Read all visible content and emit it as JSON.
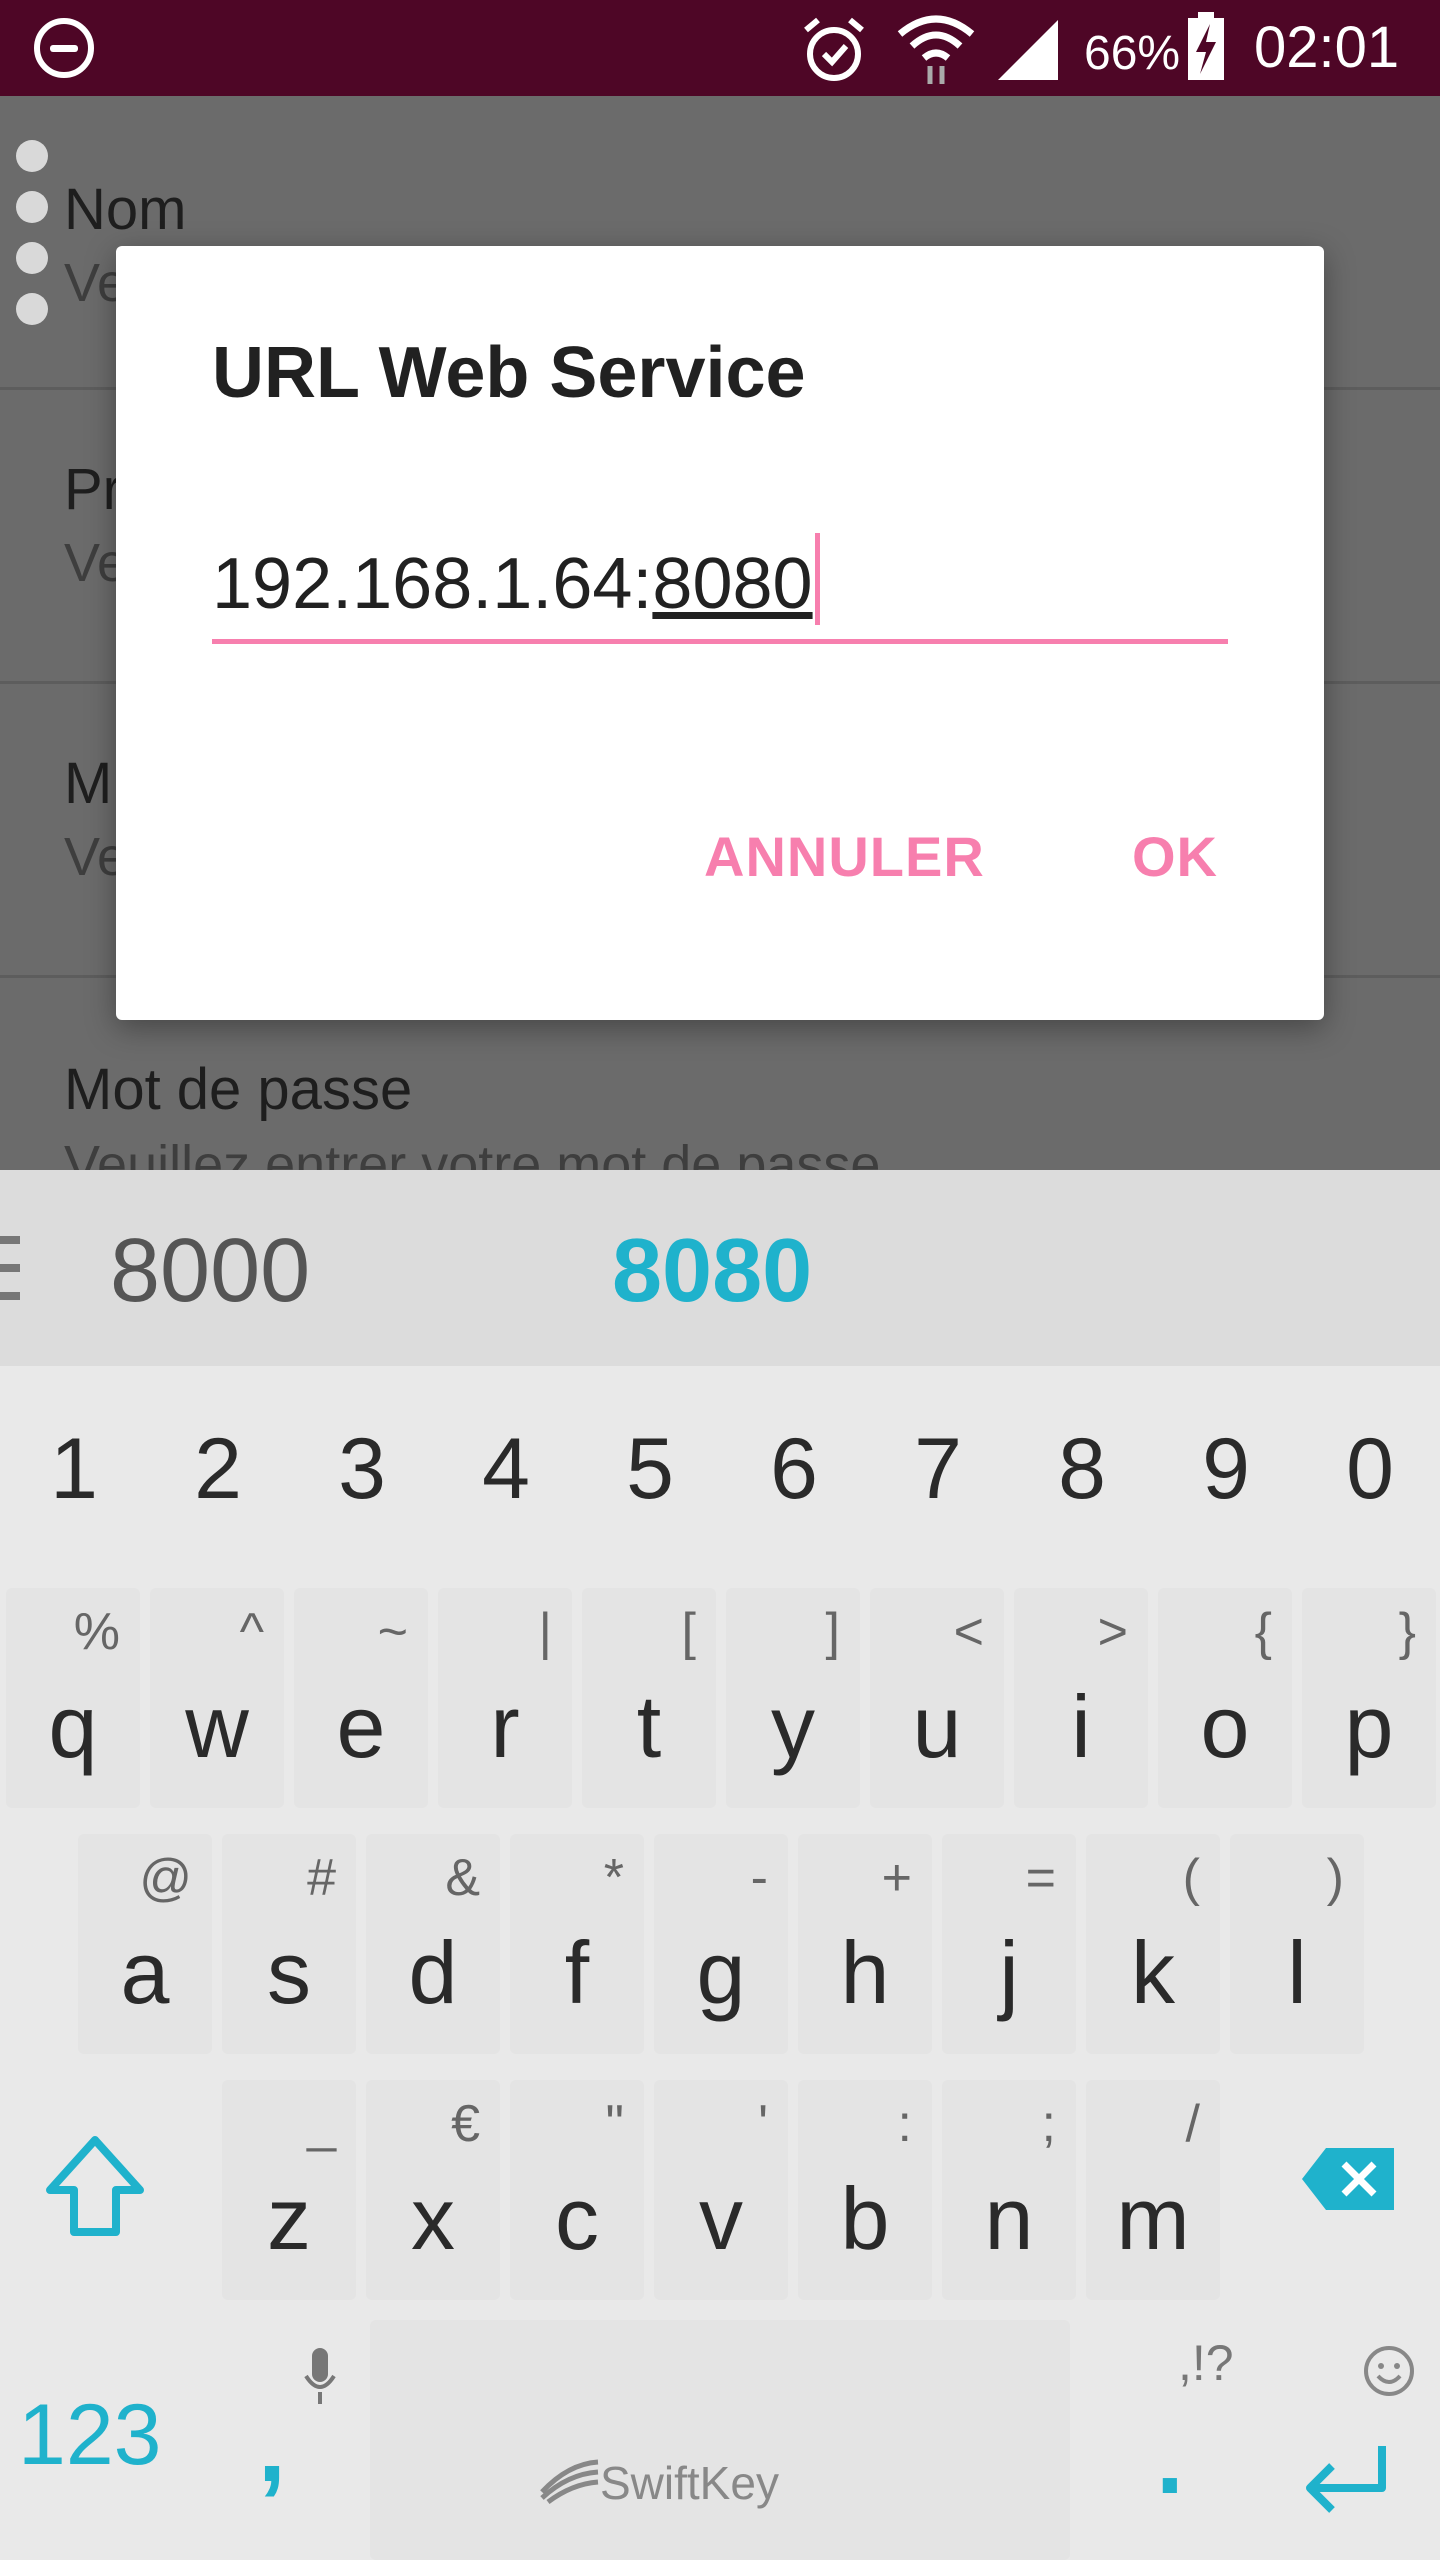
{
  "status_bar": {
    "battery": "66%",
    "time": "02:01",
    "icons": [
      "do-not-disturb-icon",
      "alarm-icon",
      "wifi-icon",
      "signal-icon",
      "battery-charging-icon"
    ]
  },
  "background_list": {
    "items": [
      {
        "title": "Nom",
        "subtitle": "Ve"
      },
      {
        "title": "Pr",
        "subtitle": "Ve"
      },
      {
        "title": "M",
        "subtitle": "Ve"
      },
      {
        "title": "Mot de passe",
        "subtitle": "Veuillez entrer votre mot de passe"
      }
    ]
  },
  "dialog": {
    "title": "URL Web Service",
    "input_value_prefix": "192.168.1.64:",
    "input_value_underlined": "8080",
    "cancel_label": "ANNULER",
    "ok_label": "OK"
  },
  "keyboard": {
    "suggestions": [
      "8000",
      "8080"
    ],
    "numbers": [
      "1",
      "2",
      "3",
      "4",
      "5",
      "6",
      "7",
      "8",
      "9",
      "0"
    ],
    "row1": [
      {
        "key": "q",
        "alt": "%"
      },
      {
        "key": "w",
        "alt": "^"
      },
      {
        "key": "e",
        "alt": "~"
      },
      {
        "key": "r",
        "alt": "|"
      },
      {
        "key": "t",
        "alt": "["
      },
      {
        "key": "y",
        "alt": "]"
      },
      {
        "key": "u",
        "alt": "<"
      },
      {
        "key": "i",
        "alt": ">"
      },
      {
        "key": "o",
        "alt": "{"
      },
      {
        "key": "p",
        "alt": "}"
      }
    ],
    "row2": [
      {
        "key": "a",
        "alt": "@"
      },
      {
        "key": "s",
        "alt": "#"
      },
      {
        "key": "d",
        "alt": "&"
      },
      {
        "key": "f",
        "alt": "*"
      },
      {
        "key": "g",
        "alt": "-"
      },
      {
        "key": "h",
        "alt": "+"
      },
      {
        "key": "j",
        "alt": "="
      },
      {
        "key": "k",
        "alt": "("
      },
      {
        "key": "l",
        "alt": ")"
      }
    ],
    "row3": [
      {
        "key": "z",
        "alt": "_"
      },
      {
        "key": "x",
        "alt": "€"
      },
      {
        "key": "c",
        "alt": "\""
      },
      {
        "key": "v",
        "alt": "'"
      },
      {
        "key": "b",
        "alt": ":"
      },
      {
        "key": "n",
        "alt": ";"
      },
      {
        "key": "m",
        "alt": "/"
      }
    ],
    "symbols_label": "123",
    "comma": ",",
    "period": ".",
    "punct_hint": ",!?",
    "brand": "SwiftKey",
    "accent_color": "#1fb2cc"
  }
}
